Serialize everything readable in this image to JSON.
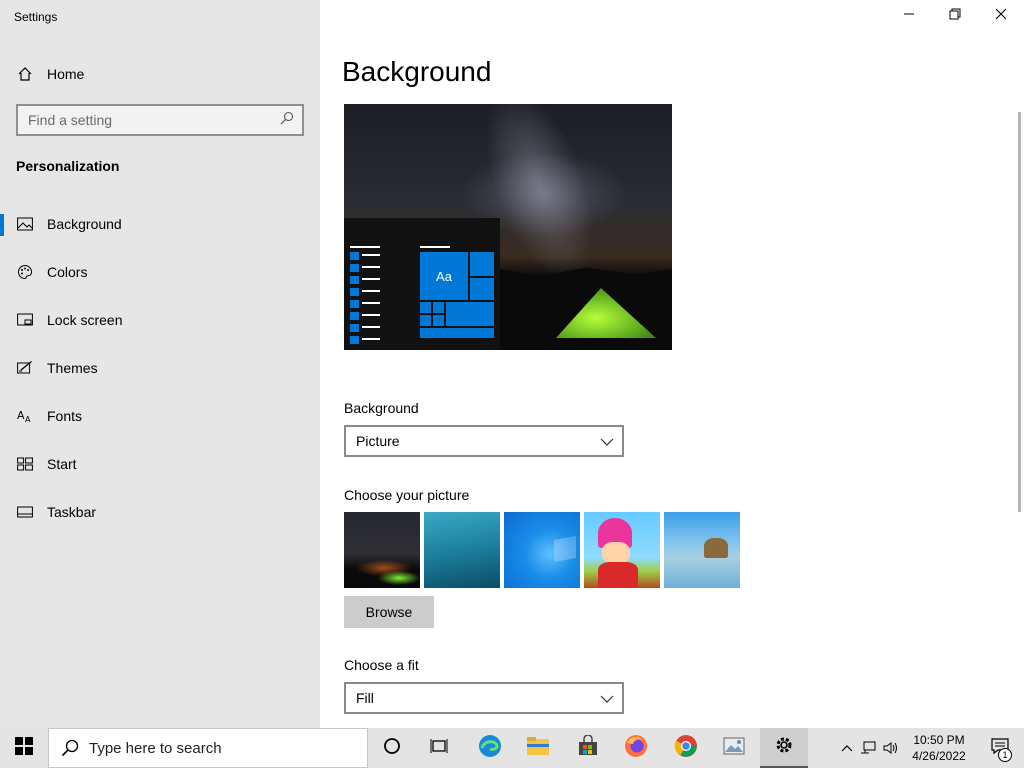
{
  "window": {
    "title": "Settings",
    "minimize_icon": "minimize-icon",
    "restore_icon": "restore-icon",
    "close_icon": "close-icon"
  },
  "sidebar": {
    "home_label": "Home",
    "search_placeholder": "Find a setting",
    "section_title": "Personalization",
    "items": [
      {
        "label": "Background",
        "icon": "picture-icon",
        "active": true
      },
      {
        "label": "Colors",
        "icon": "palette-icon"
      },
      {
        "label": "Lock screen",
        "icon": "lock-screen-icon"
      },
      {
        "label": "Themes",
        "icon": "themes-icon"
      },
      {
        "label": "Fonts",
        "icon": "fonts-icon"
      },
      {
        "label": "Start",
        "icon": "start-icon"
      },
      {
        "label": "Taskbar",
        "icon": "taskbar-icon"
      }
    ]
  },
  "main": {
    "page_title": "Background",
    "preview": {
      "tile_text": "Aa"
    },
    "background_label": "Background",
    "background_value": "Picture",
    "choose_picture_label": "Choose your picture",
    "browse_label": "Browse",
    "choose_fit_label": "Choose a fit",
    "fit_value": "Fill"
  },
  "taskbar": {
    "search_placeholder": "Type here to search",
    "apps": [
      "cortana-icon",
      "task-view-icon",
      "edge-icon",
      "file-explorer-icon",
      "store-icon",
      "firefox-icon",
      "chrome-icon",
      "photos-icon",
      "settings-icon"
    ],
    "time": "10:50 PM",
    "date": "4/26/2022",
    "notification_count": "1"
  },
  "colors": {
    "accent": "#0078d7",
    "sidebar_bg": "#e6e6e6",
    "taskbar_bg": "#e4e4e4"
  }
}
